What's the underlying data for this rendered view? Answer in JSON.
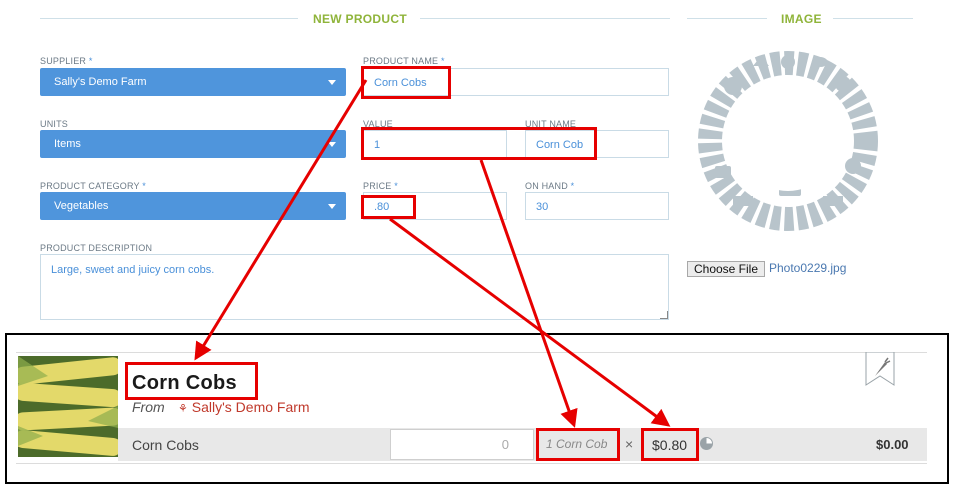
{
  "sections": {
    "new_product": "NEW PRODUCT",
    "image": "IMAGE"
  },
  "form": {
    "supplier": {
      "label": "SUPPLIER",
      "required": "*",
      "value": "Sally's Demo Farm"
    },
    "units": {
      "label": "UNITS",
      "value": "Items"
    },
    "category": {
      "label": "PRODUCT CATEGORY",
      "required": "*",
      "value": "Vegetables"
    },
    "product_name": {
      "label": "PRODUCT NAME",
      "required": "*",
      "value": "Corn Cobs"
    },
    "value": {
      "label": "VALUE",
      "value": "1"
    },
    "unit_name": {
      "label": "UNIT NAME",
      "value": "Corn Cob"
    },
    "price": {
      "label": "PRICE",
      "required": "*",
      "value": ".80"
    },
    "on_hand": {
      "label": "ON HAND",
      "required": "*",
      "value": "30"
    },
    "description": {
      "label": "PRODUCT DESCRIPTION",
      "value": "Large, sweet and juicy corn cobs."
    }
  },
  "image": {
    "choose_file_label": "Choose File",
    "file_name": "Photo0229.jpg"
  },
  "preview": {
    "title": "Corn Cobs",
    "from_label": "From",
    "supplier": "Sally's Demo Farm",
    "variant_name": "Corn Cobs",
    "quantity": "0",
    "unit": "1 Corn Cob",
    "times": "×",
    "price": "$0.80",
    "total": "$0.00"
  },
  "colors": {
    "accent_green": "#8fb43a",
    "select_blue": "#4f95dc",
    "annotation_red": "#e60000",
    "supplier_red": "#c0392b"
  }
}
